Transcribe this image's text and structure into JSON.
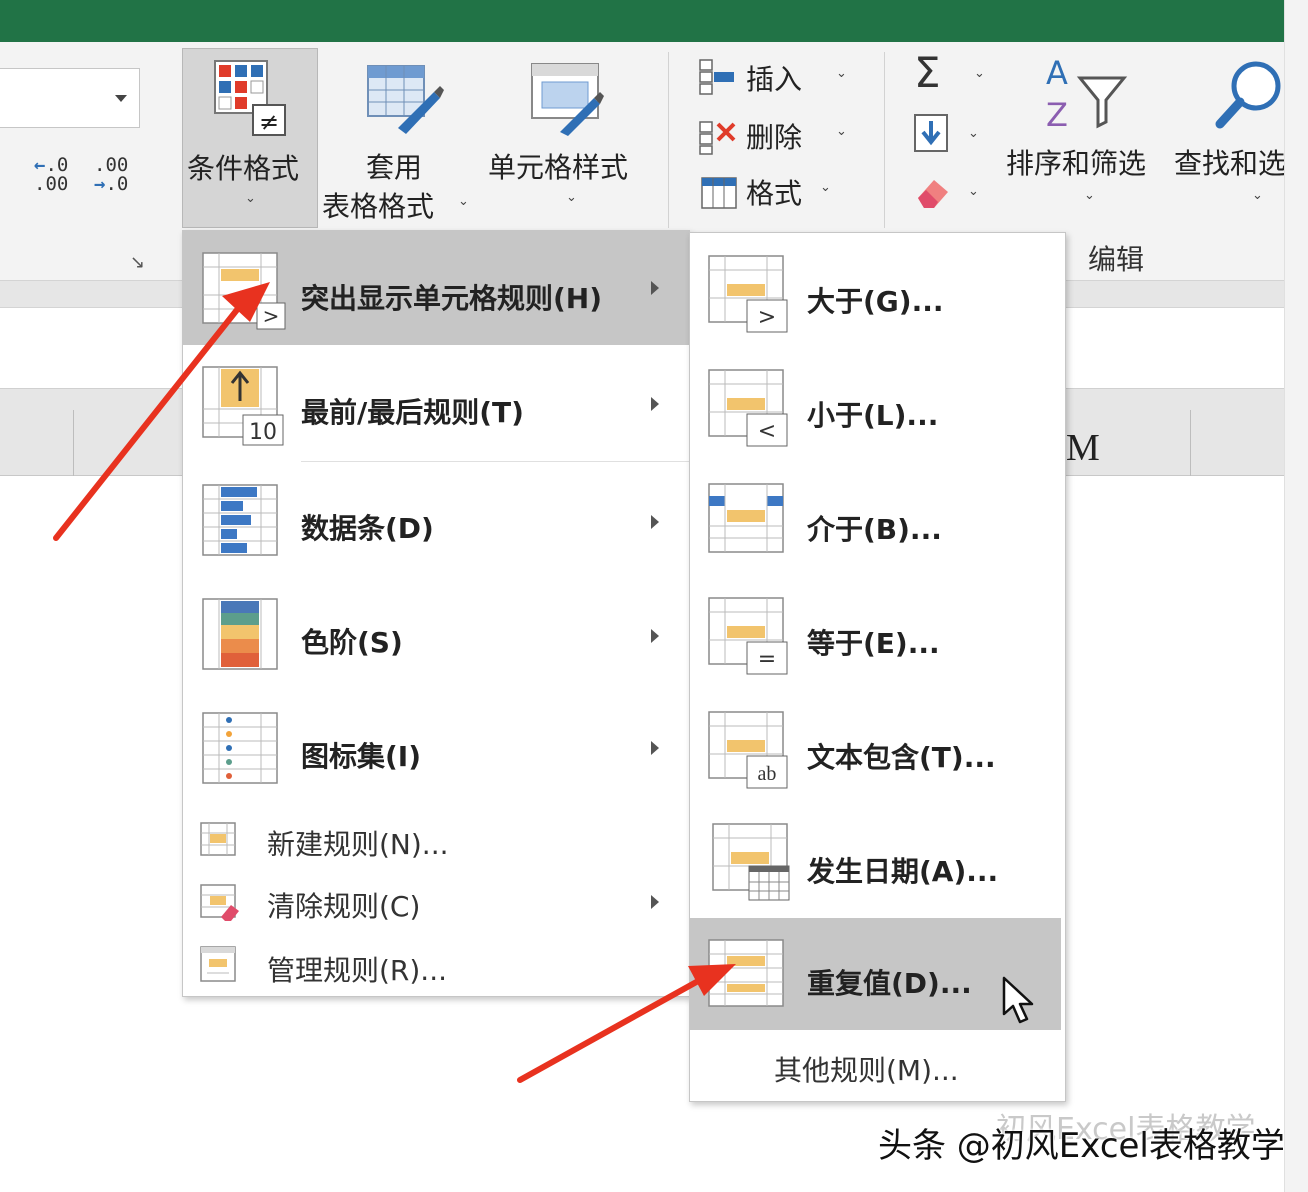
{
  "ribbon": {
    "conditional_formatting": "条件格式",
    "format_as_table_line1": "套用",
    "format_as_table_line2": "表格格式",
    "cell_styles": "单元格样式",
    "insert": "插入",
    "delete": "删除",
    "format": "格式",
    "sort_filter": "排序和筛选",
    "find_select": "查找和选",
    "editing_group": "编辑",
    "increase_decimal": ".00",
    "decrease_decimal": ".0",
    "sigma": "Σ"
  },
  "sheet": {
    "column_label_right": "M"
  },
  "main_menu": {
    "items": [
      {
        "label": "突出显示单元格规则(H)",
        "icon": "highlight-rules-icon",
        "submenu": true,
        "highlighted": true
      },
      {
        "label": "最前/最后规则(T)",
        "icon": "top-bottom-rules-icon",
        "submenu": true,
        "icon_text": "10"
      },
      {
        "label": "数据条(D)",
        "icon": "data-bars-icon",
        "submenu": true
      },
      {
        "label": "色阶(S)",
        "icon": "color-scales-icon",
        "submenu": true
      },
      {
        "label": "图标集(I)",
        "icon": "icon-sets-icon",
        "submenu": true
      },
      {
        "label": "新建规则(N)...",
        "icon": "new-rule-icon",
        "submenu": false
      },
      {
        "label": "清除规则(C)",
        "icon": "clear-rules-icon",
        "submenu": true
      },
      {
        "label": "管理规则(R)...",
        "icon": "manage-rules-icon",
        "submenu": false
      }
    ]
  },
  "sub_menu": {
    "items": [
      {
        "label": "大于(G)...",
        "icon": "greater-than-icon",
        "symbol": ">"
      },
      {
        "label": "小于(L)...",
        "icon": "less-than-icon",
        "symbol": "<"
      },
      {
        "label": "介于(B)...",
        "icon": "between-icon",
        "symbol": ""
      },
      {
        "label": "等于(E)...",
        "icon": "equal-to-icon",
        "symbol": "="
      },
      {
        "label": "文本包含(T)...",
        "icon": "text-contains-icon",
        "symbol": "ab"
      },
      {
        "label": "发生日期(A)...",
        "icon": "date-occurring-icon",
        "symbol": ""
      },
      {
        "label": "重复值(D)...",
        "icon": "duplicate-values-icon",
        "symbol": "",
        "highlighted": true
      }
    ],
    "more_rules": "其他规则(M)..."
  },
  "watermark": {
    "line_faint": "初风Excel表格教学",
    "line_main": "头条 @初风Excel表格教学"
  },
  "colors": {
    "title_green": "#217346",
    "ribbon_bg": "#f3f3f3",
    "menu_highlight": "#c6c6c6",
    "cell_fill_yellow": "#f2c46d",
    "arrow_red": "#e8321f",
    "icon_blue": "#2f6fb5"
  }
}
